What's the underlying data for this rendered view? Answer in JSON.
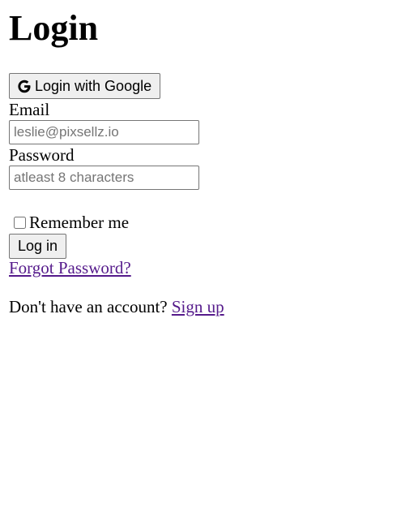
{
  "page": {
    "title": "Login"
  },
  "google_button": {
    "icon": "google-g-icon",
    "label": "Login with Google"
  },
  "email": {
    "label": "Email",
    "placeholder": "leslie@pixsellz.io",
    "value": ""
  },
  "password": {
    "label": "Password",
    "placeholder": "atleast 8 characters",
    "value": ""
  },
  "remember": {
    "label": "Remember me",
    "checked": false
  },
  "login_button": {
    "label": "Log in"
  },
  "forgot_link": {
    "label": "Forgot Password?"
  },
  "signup": {
    "prompt": "Don't have an account?",
    "link_label": "Sign up"
  },
  "colors": {
    "visited_link": "#551a8b",
    "button_bg": "#efefef",
    "border": "#767676",
    "placeholder": "#757575"
  }
}
